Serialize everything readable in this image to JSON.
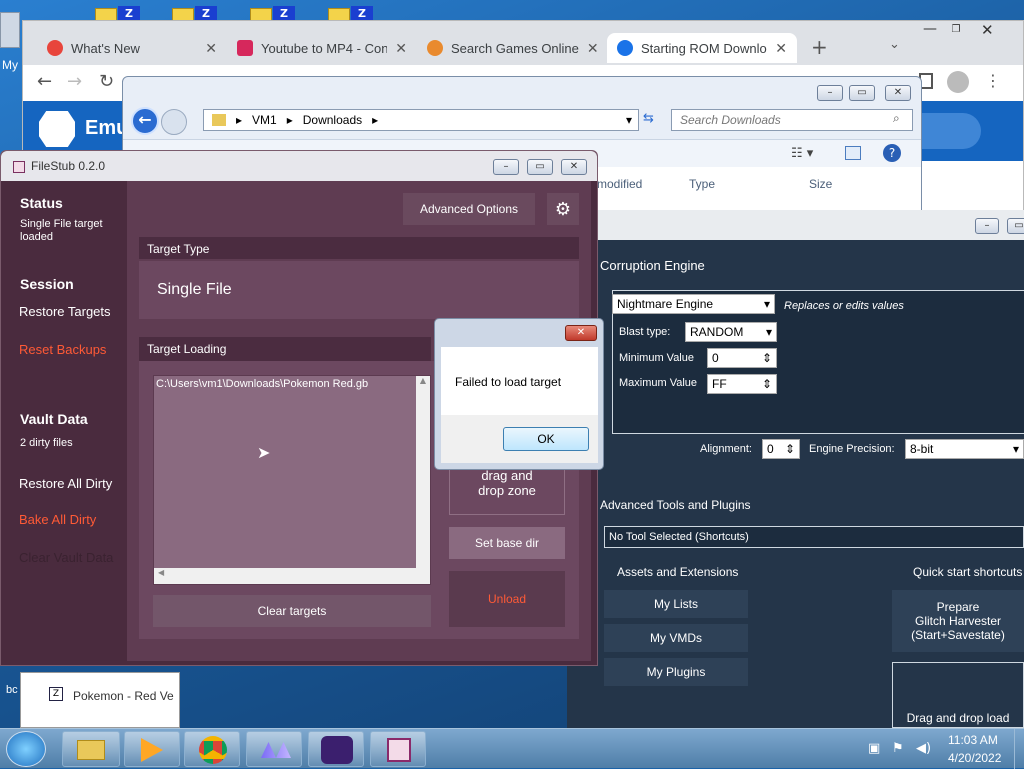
{
  "desktop": {
    "icon_labels": [
      "My",
      "bc"
    ],
    "zip_icon_letter": "Z",
    "peek_window": {
      "title": "Pokemon - Red Ve"
    }
  },
  "chrome": {
    "tabs": [
      {
        "title": "What's New",
        "color": "#e8453c"
      },
      {
        "title": "Youtube to MP4 - Conv",
        "color": "#d6285c"
      },
      {
        "title": "Search Games Online",
        "color": "#e98a2e"
      },
      {
        "title": "Starting ROM Downloa",
        "color": "#1a73e8"
      }
    ],
    "new_tab": "+",
    "site_partial": "Emu"
  },
  "explorer": {
    "breadcrumb": [
      "VM1",
      "Downloads"
    ],
    "search_placeholder": "Search Downloads",
    "columns": [
      "modified",
      "Type",
      "Size"
    ]
  },
  "rtc": {
    "corruption_engine_label": "Corruption Engine",
    "engine": "Nightmare Engine",
    "engine_desc": "Replaces or edits values",
    "blast_type_label": "Blast type:",
    "blast_type": "RANDOM",
    "min_label": "Minimum Value",
    "min_value": "0",
    "max_label": "Maximum Value",
    "max_value": "FF",
    "alignment_label": "Alignment:",
    "alignment_value": "0",
    "precision_label": "Engine Precision:",
    "precision_value": "8-bit",
    "adv_tools_label": "Advanced Tools and Plugins",
    "tool_select": "No Tool Selected (Shortcuts)",
    "assets_label": "Assets and Extensions",
    "quick_label": "Quick start shortcuts",
    "my_lists": "My Lists",
    "my_vmds": "My VMDs",
    "my_plugins": "My Plugins",
    "prepare_line1": "Prepare",
    "prepare_line2": "Glitch Harvester",
    "prepare_line3": "(Start+Savestate)",
    "drag_drop_load": "Drag and drop load"
  },
  "filestub": {
    "title": "FileStub 0.2.0",
    "status_label": "Status",
    "status_text": "Single File target loaded",
    "session_label": "Session",
    "restore_targets": "Restore Targets",
    "reset_backups": "Reset Backups",
    "vault_label": "Vault Data",
    "vault_count": "2 dirty files",
    "restore_all_dirty": "Restore All Dirty",
    "bake_all_dirty": "Bake All Dirty",
    "clear_vault": "Clear Vault Data",
    "advanced_options": "Advanced Options",
    "target_type_label": "Target Type",
    "target_type_value": "Single File",
    "target_loading_label": "Target Loading",
    "target_path": "C:\\Users\\vm1\\Downloads\\Pokemon Red.gb",
    "drop_zone_line1": "drag and",
    "drop_zone_line2": "drop zone",
    "set_base_dir": "Set base dir",
    "unload": "Unload",
    "clear_targets": "Clear targets"
  },
  "dialog": {
    "message": "Failed to load target",
    "ok": "OK"
  },
  "taskbar": {
    "time": "11:03 AM",
    "date": "4/20/2022"
  }
}
